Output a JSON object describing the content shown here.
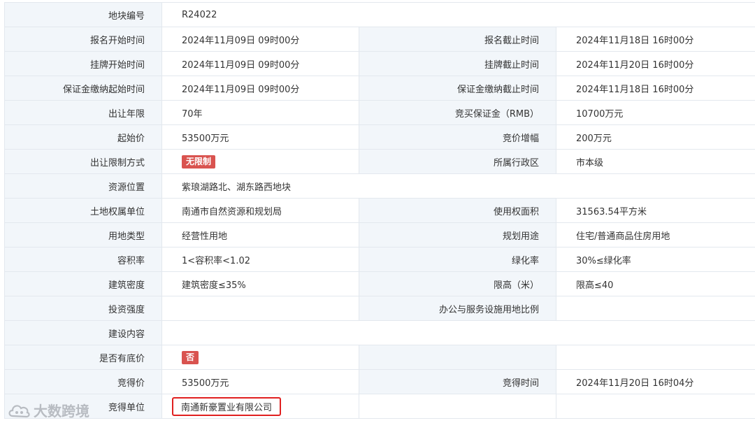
{
  "rows": [
    {
      "l1": "地块编号",
      "v1": "R24022"
    },
    {
      "l1": "报名开始时间",
      "v1": "2024年11月09日 09时00分",
      "l2": "报名截止时间",
      "v2": "2024年11月18日 16时00分"
    },
    {
      "l1": "挂牌开始时间",
      "v1": "2024年11月09日 09时00分",
      "l2": "挂牌截止时间",
      "v2": "2024年11月20日 16时00分"
    },
    {
      "l1": "保证金缴纳起始时间",
      "v1": "2024年11月09日 09时00分",
      "l2": "保证金缴纳截止时间",
      "v2": "2024年11月18日 16时00分"
    },
    {
      "l1": "出让年限",
      "v1": "70年",
      "l2": "竞买保证金（RMB）",
      "v2": "10700万元"
    },
    {
      "l1": "起始价",
      "v1": "53500万元",
      "l2": "竞价增幅",
      "v2": "200万元"
    },
    {
      "l1": "出让限制方式",
      "badge1": "无限制",
      "l2": "所属行政区",
      "v2": "市本级"
    },
    {
      "l1": "资源位置",
      "v1": "紫琅湖路北、湖东路西地块"
    },
    {
      "l1": "土地权属单位",
      "v1": "南通市自然资源和规划局",
      "l2": "使用权面积",
      "v2": "31563.54平方米"
    },
    {
      "l1": "用地类型",
      "v1": "经营性用地",
      "l2": "规划用途",
      "v2": "住宅/普通商品住房用地"
    },
    {
      "l1": "容积率",
      "v1": "1<容积率<1.02",
      "l2": "绿化率",
      "v2": "30%≤绿化率"
    },
    {
      "l1": "建筑密度",
      "v1": "建筑密度≤35%",
      "l2": "限高（米）",
      "v2": "限高≤40"
    },
    {
      "l1": "投资强度",
      "v1": "",
      "l2": "办公与服务设施用地比例",
      "v2": ""
    },
    {
      "l1": "建设内容",
      "v1": ""
    },
    {
      "l1": "是否有底价",
      "badge1": "否",
      "l2": "",
      "v2": ""
    },
    {
      "l1": "竞得价",
      "v1": "53500万元",
      "l2": "竞得时间",
      "v2": "2024年11月20日 16时04分"
    },
    {
      "l1": "竞得单位",
      "v1": "南通新豪置业有限公司",
      "l2": "",
      "v2": ""
    }
  ],
  "watermark": {
    "text": "大数跨境",
    "icon": "cloud-logo-icon"
  },
  "colors": {
    "label_bg": "#f2f6fa",
    "border": "#e3e8ee",
    "badge": "#d9534f",
    "highlight": "#e02020"
  }
}
